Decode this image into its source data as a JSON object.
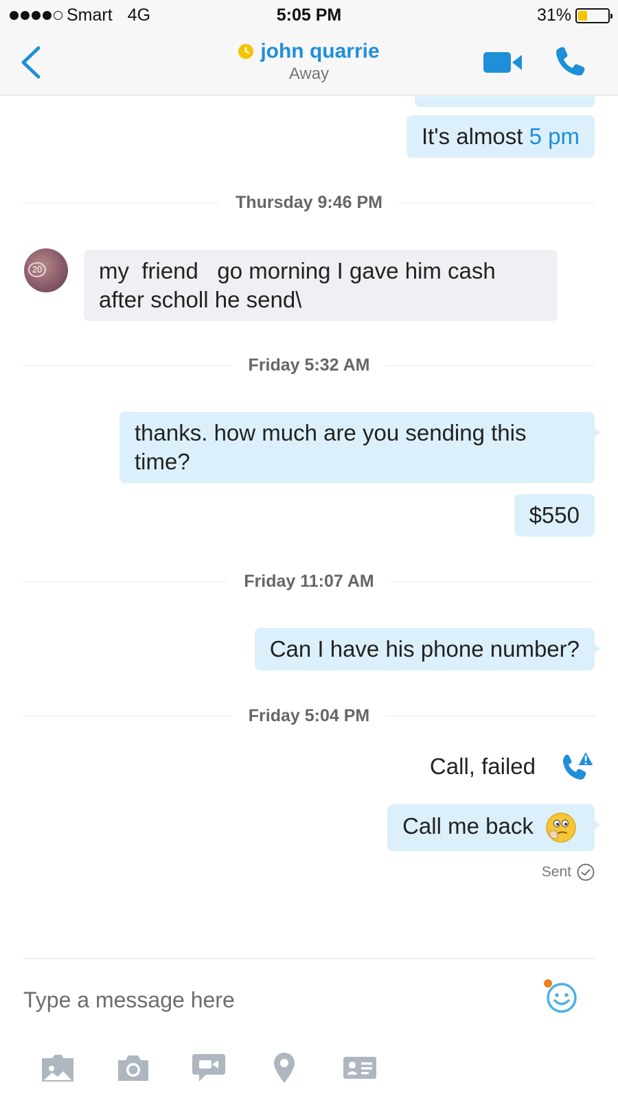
{
  "status_bar": {
    "carrier": "Smart",
    "network": "4G",
    "time": "5:05 PM",
    "battery": "31%",
    "battery_level": 0.31
  },
  "header": {
    "contact_name": "john quarrie",
    "contact_status": "Away",
    "icons": {
      "back": "chevron-left-icon",
      "status": "clock-icon",
      "video": "video-call-icon",
      "call": "phone-icon"
    }
  },
  "colors": {
    "accent": "#1e8fd8",
    "outgoing_bubble": "#dcf0fb",
    "incoming_bubble": "#eef0f3",
    "away": "#f5c400",
    "notify": "#f08020"
  },
  "messages": {
    "m1": {
      "text_before": "It's almost ",
      "text_link": "5 pm"
    },
    "sep1": "Thursday 9:46 PM",
    "m2_line1": "my  friend   go morning I gave him cash",
    "m2_line2": "after scholl he send\\",
    "sep2": "Friday 5:32 AM",
    "m3_line1": "thanks. how much are you sending this",
    "m3_line2": "time?",
    "m4": "$550",
    "sep3": "Friday 11:07 AM",
    "m5": "Can I have his phone number?",
    "sep4": "Friday 5:04 PM",
    "call_failed": "Call, failed",
    "m6": "Call me back",
    "sent": "Sent",
    "avatar_badge": "20"
  },
  "compose": {
    "placeholder": "Type a message here"
  },
  "toolbar": [
    {
      "icon": "media-folder-icon"
    },
    {
      "icon": "camera-icon"
    },
    {
      "icon": "video-message-icon"
    },
    {
      "icon": "location-pin-icon"
    },
    {
      "icon": "contact-card-icon"
    }
  ]
}
